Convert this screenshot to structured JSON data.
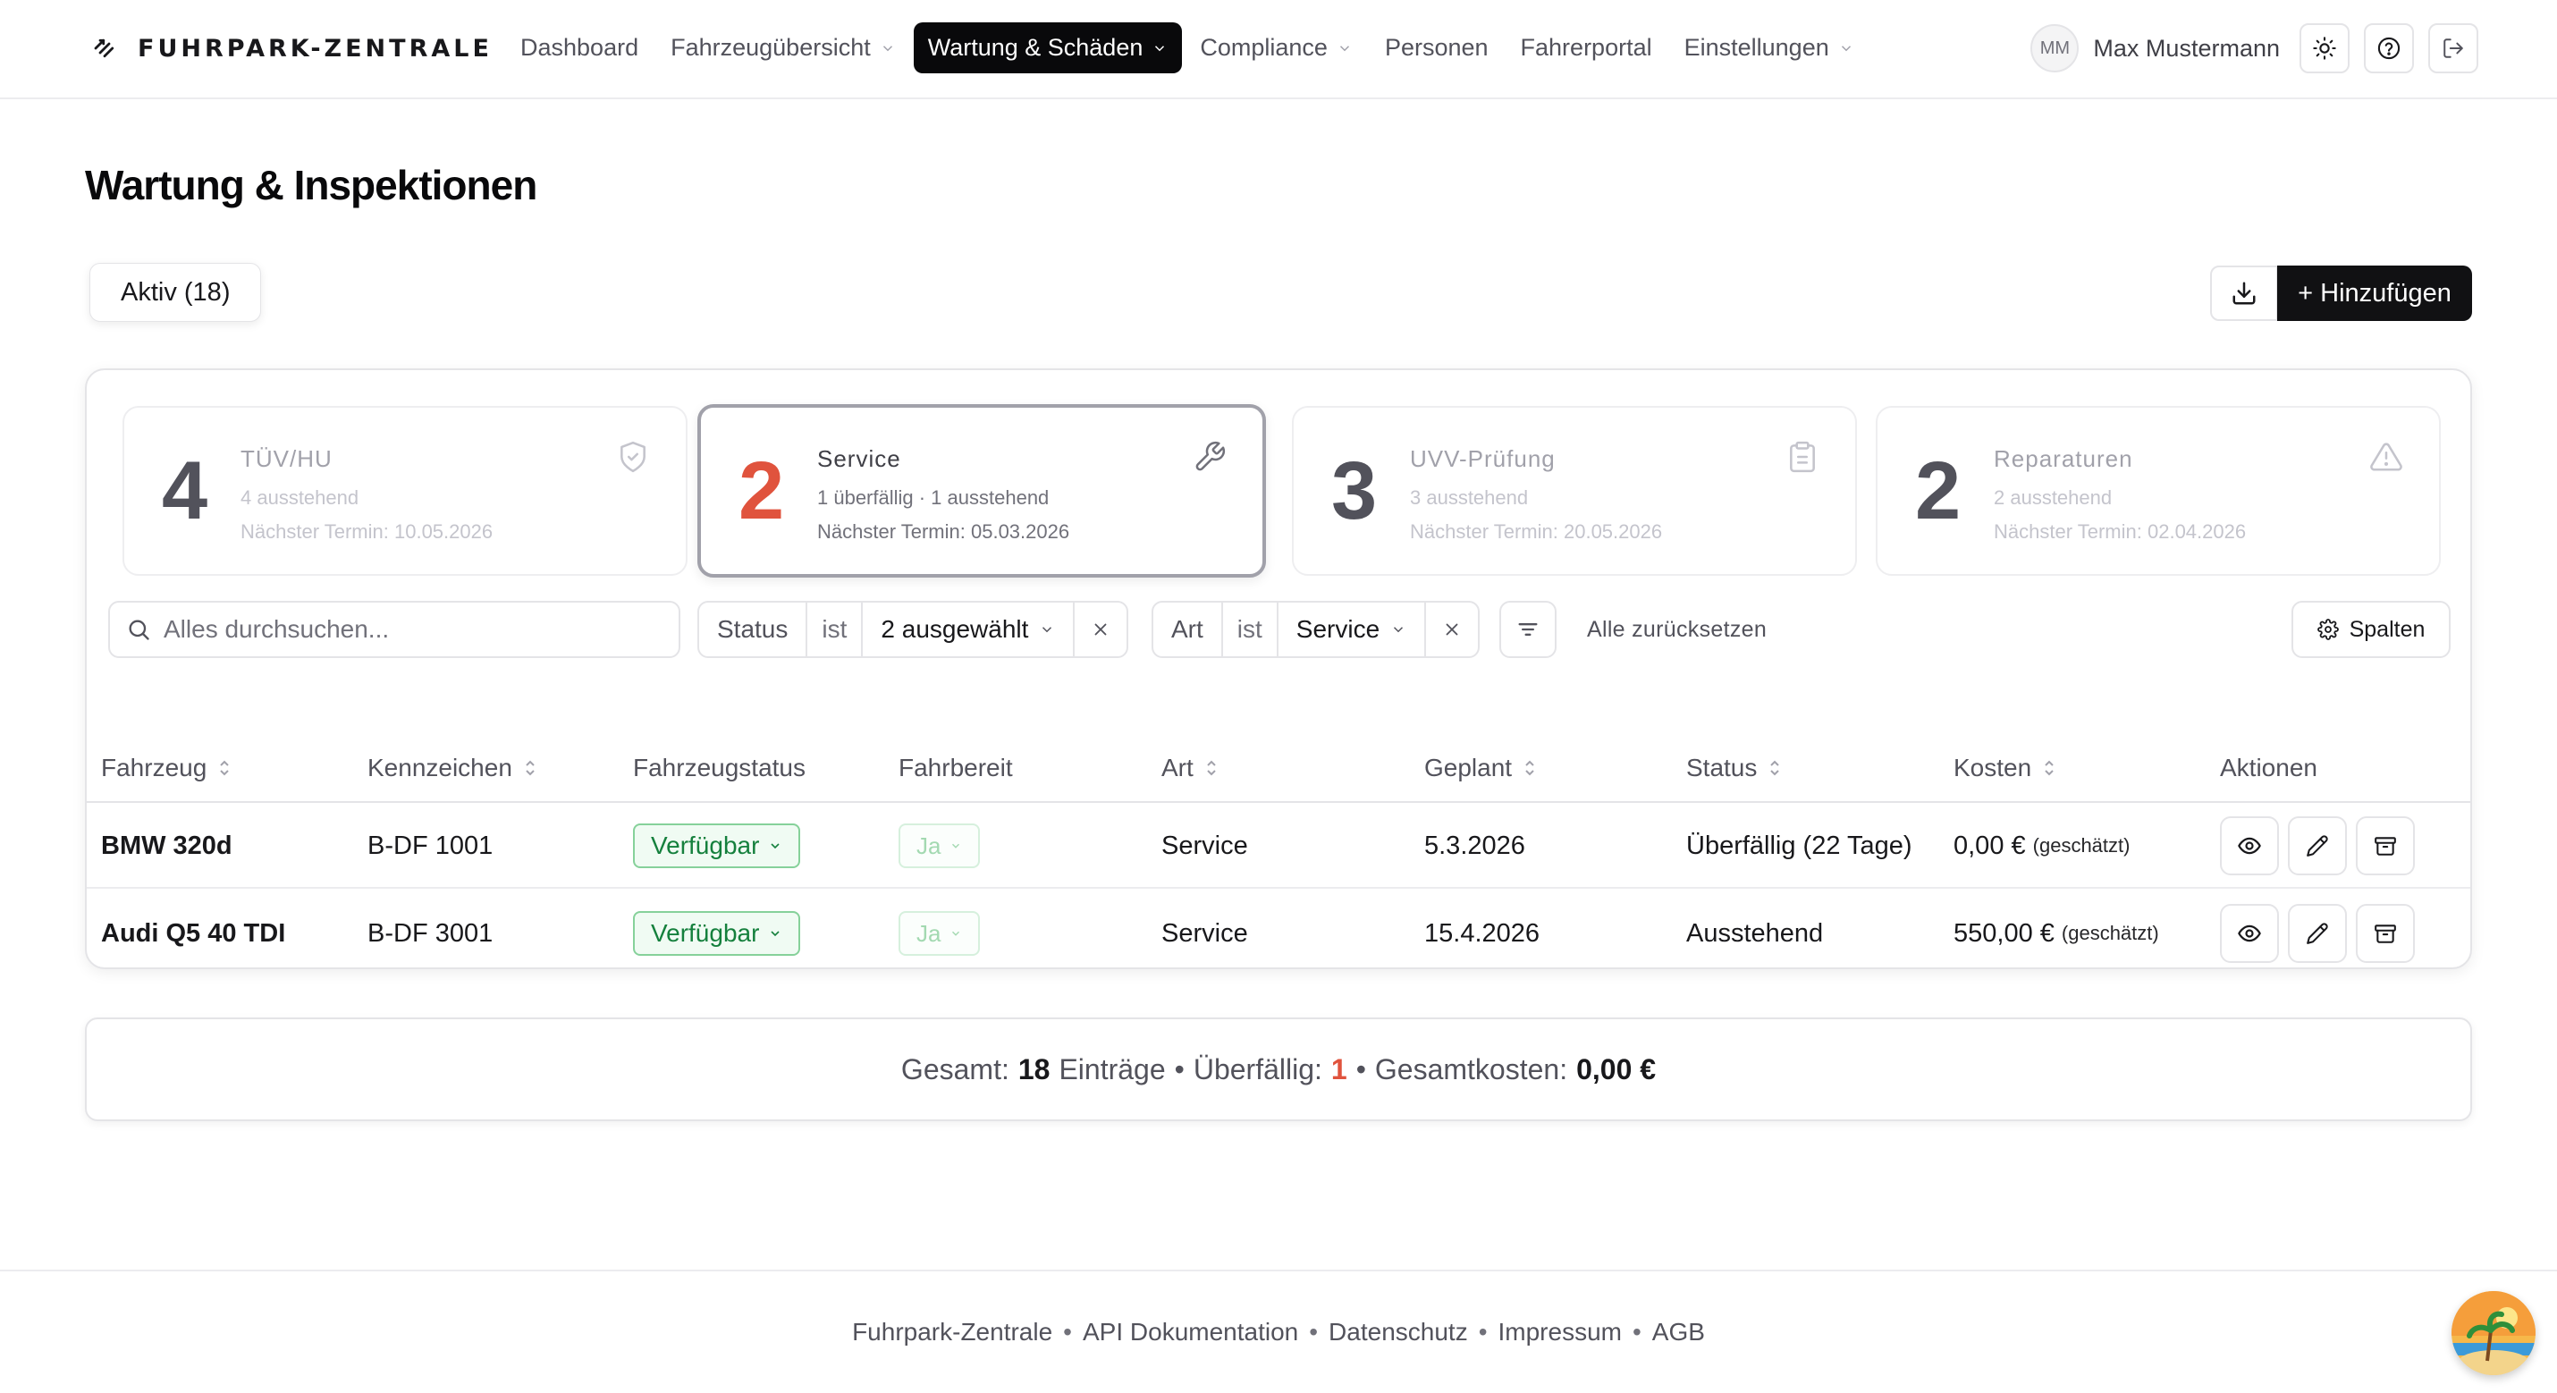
{
  "header": {
    "brand": "FUHRPARK-ZENTRALE",
    "nav": [
      {
        "label": "Dashboard",
        "dropdown": false,
        "active": false
      },
      {
        "label": "Fahrzeugübersicht",
        "dropdown": true,
        "active": false
      },
      {
        "label": "Wartung & Schäden",
        "dropdown": true,
        "active": true
      },
      {
        "label": "Compliance",
        "dropdown": true,
        "active": false
      },
      {
        "label": "Personen",
        "dropdown": false,
        "active": false
      },
      {
        "label": "Fahrerportal",
        "dropdown": false,
        "active": false
      },
      {
        "label": "Einstellungen",
        "dropdown": true,
        "active": false
      }
    ],
    "user_initials": "MM",
    "user_name": "Max Mustermann",
    "icons": [
      "sun-icon",
      "help-circle-icon",
      "logout-icon"
    ]
  },
  "page": {
    "title": "Wartung & Inspektionen",
    "tab_label": "Aktiv (18)",
    "add_button": "+ Hinzufügen"
  },
  "stats": [
    {
      "count": "4",
      "title": "TÜV/HU",
      "sub": "4 ausstehend",
      "next": "Nächster Termin: 10.05.2026",
      "icon": "shield-check-icon",
      "selected": false
    },
    {
      "count": "2",
      "title": "Service",
      "sub": "1 überfällig · 1 ausstehend",
      "next": "Nächster Termin: 05.03.2026",
      "icon": "wrench-icon",
      "selected": true
    },
    {
      "count": "3",
      "title": "UVV-Prüfung",
      "sub": "3 ausstehend",
      "next": "Nächster Termin: 20.05.2026",
      "icon": "clipboard-icon",
      "selected": false
    },
    {
      "count": "2",
      "title": "Reparaturen",
      "sub": "2 ausstehend",
      "next": "Nächster Termin: 02.04.2026",
      "icon": "alert-triangle-icon",
      "selected": false
    }
  ],
  "filters": {
    "search_placeholder": "Alles durchsuchen...",
    "status": {
      "label": "Status",
      "op": "ist",
      "value": "2 ausgewählt"
    },
    "art": {
      "label": "Art",
      "op": "ist",
      "value": "Service"
    },
    "reset": "Alle zurücksetzen",
    "columns": "Spalten"
  },
  "table": {
    "columns": [
      "Fahrzeug",
      "Kennzeichen",
      "Fahrzeugstatus",
      "Fahrbereit",
      "Art",
      "Geplant",
      "Status",
      "Kosten",
      "Aktionen"
    ],
    "rows": [
      {
        "fahrzeug": "BMW 320d",
        "kennzeichen": "B-DF 1001",
        "fahrzeugstatus": "Verfügbar",
        "fahrbereit": "Ja",
        "art": "Service",
        "geplant": "5.3.2026",
        "status": "Überfällig (22 Tage)",
        "kosten": "0,00 €",
        "kosten_note": "(geschätzt)"
      },
      {
        "fahrzeug": "Audi Q5 40 TDI",
        "kennzeichen": "B-DF 3001",
        "fahrzeugstatus": "Verfügbar",
        "fahrbereit": "Ja",
        "art": "Service",
        "geplant": "15.4.2026",
        "status": "Ausstehend",
        "kosten": "550,00 €",
        "kosten_note": "(geschätzt)"
      }
    ]
  },
  "summary": {
    "gesamt_label": "Gesamt:",
    "gesamt_value": "18",
    "eintraege": "Einträge",
    "ueberfaellig_label": "Überfällig:",
    "ueberfaellig_value": "1",
    "kosten_label": "Gesamtkosten:",
    "kosten_value": "0,00 €"
  },
  "footer": {
    "links": [
      "Fuhrpark-Zentrale",
      "API Dokumentation",
      "Datenschutz",
      "Impressum",
      "AGB"
    ],
    "separator": "•"
  },
  "colors": {
    "accent_dark": "#09090b",
    "overdue_red": "#e0533d",
    "available_green": "#15803d"
  }
}
